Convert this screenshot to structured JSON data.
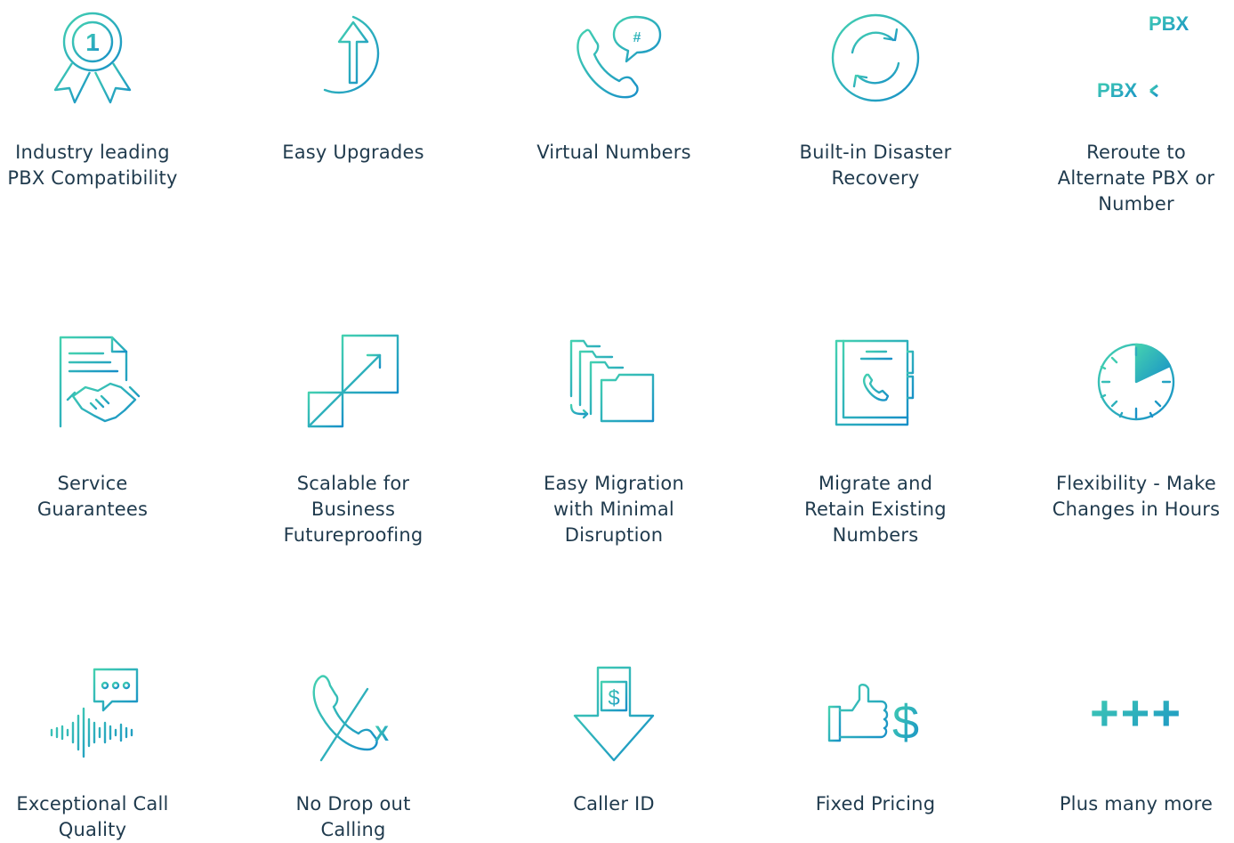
{
  "colors": {
    "accent_light": "#3cc9b3",
    "accent_dark": "#1a97c4",
    "text": "#1f3a4d"
  },
  "features": [
    {
      "label": "Industry leading PBX Compatibility",
      "icon": "award-ribbon-icon"
    },
    {
      "label": "Easy Upgrades",
      "icon": "upgrade-arrow-icon"
    },
    {
      "label": "Virtual Numbers",
      "icon": "phone-chat-icon"
    },
    {
      "label": "Built-in Disaster Recovery",
      "icon": "refresh-cycle-icon"
    },
    {
      "label": "Reroute to Alternate PBX or Number",
      "icon": "reroute-icon",
      "icon_text": "PBX",
      "icon_text_2": "PBX"
    },
    {
      "label": "Service Guarantees",
      "icon": "contract-handshake-icon"
    },
    {
      "label": "Scalable for Business Futureproofing",
      "icon": "scale-up-icon"
    },
    {
      "label": "Easy Migration with Minimal Disruption",
      "icon": "folder-migration-icon"
    },
    {
      "label": "Migrate and Retain Existing Numbers",
      "icon": "phone-book-icon"
    },
    {
      "label": "Flexibility - Make Changes in Hours",
      "icon": "timer-icon"
    },
    {
      "label": "Exceptional Call Quality",
      "icon": "voice-wave-chat-icon"
    },
    {
      "label": "No Drop out Calling",
      "icon": "phone-no-drop-icon",
      "icon_text": "X"
    },
    {
      "label": "Caller ID",
      "icon": "receipt-dollar-icon",
      "icon_text": "$"
    },
    {
      "label": "Fixed Pricing",
      "icon": "thumbs-up-dollar-icon",
      "icon_text": "$"
    },
    {
      "label": "Plus many more",
      "icon": "plus-icon",
      "icon_text": "+++"
    }
  ]
}
